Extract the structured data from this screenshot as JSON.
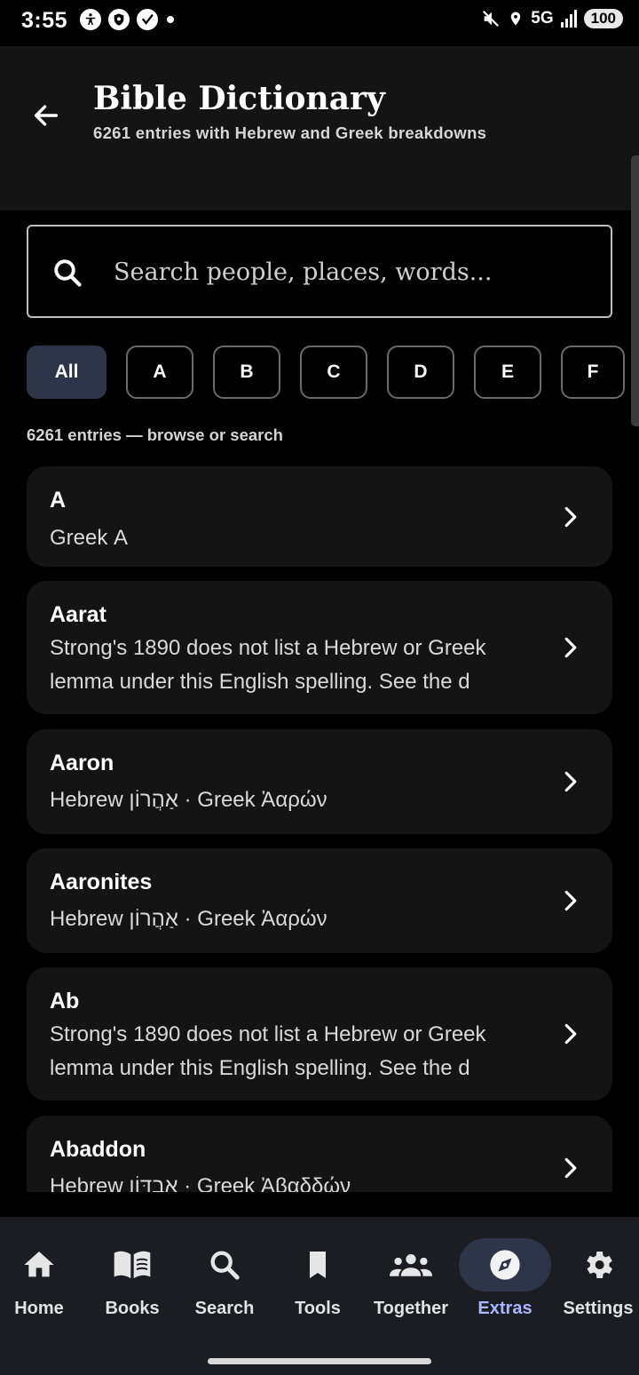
{
  "status_bar": {
    "time": "3:55",
    "network": "5G",
    "battery": "100"
  },
  "header": {
    "title": "Bible Dictionary",
    "subtitle": "6261 entries with Hebrew and Greek breakdowns"
  },
  "search": {
    "placeholder": "Search people, places, words..."
  },
  "letter_filters": [
    "All",
    "A",
    "B",
    "C",
    "D",
    "E",
    "F"
  ],
  "selected_filter": "All",
  "count_text": "6261 entries — browse or search",
  "entries": [
    {
      "title": "A",
      "desc": "Greek Α"
    },
    {
      "title": "Aarat",
      "desc": "Strong's 1890 does not list a Hebrew or Greek lemma under this English spelling. See the d"
    },
    {
      "title": "Aaron",
      "desc": "Hebrew אַהֲרוֹן · Greek Ἀαρών"
    },
    {
      "title": "Aaronites",
      "desc": "Hebrew אַהֲרוֹן · Greek Ἀαρών"
    },
    {
      "title": "Ab",
      "desc": "Strong's 1890 does not list a Hebrew or Greek lemma under this English spelling. See the d"
    },
    {
      "title": "Abaddon",
      "desc": "Hebrew אֲבַדּוֹן · Greek Ἀβαδδών"
    }
  ],
  "bottom_nav": {
    "items": [
      {
        "label": "Home",
        "icon": "home-icon"
      },
      {
        "label": "Books",
        "icon": "book-open-icon"
      },
      {
        "label": "Search",
        "icon": "search-icon"
      },
      {
        "label": "Tools",
        "icon": "bookmark-icon"
      },
      {
        "label": "Together",
        "icon": "group-icon"
      },
      {
        "label": "Extras",
        "icon": "compass-icon"
      },
      {
        "label": "Settings",
        "icon": "gear-icon"
      }
    ],
    "active": "Extras"
  },
  "colors": {
    "accent": "#a9b7ff",
    "active_chip_bg": "#2e3548",
    "card_bg": "#141414",
    "nav_bg": "#1c1d22"
  }
}
